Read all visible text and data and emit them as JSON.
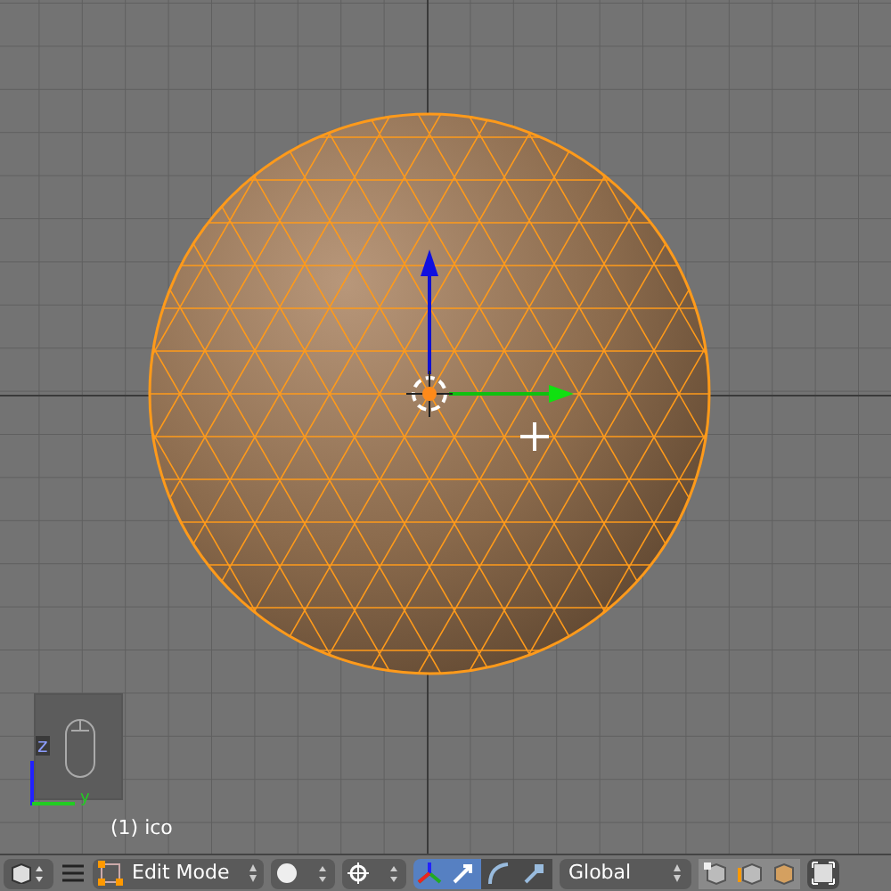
{
  "viewport": {
    "object_label": "(1) ico",
    "axis_labels": [
      "z",
      "y"
    ]
  },
  "header": {
    "mode": "Edit Mode",
    "orientation": "Global",
    "manipulator_enabled": true,
    "manipulators": [
      {
        "kind": "translate",
        "selected": true
      },
      {
        "kind": "rotate",
        "selected": false
      },
      {
        "kind": "scale",
        "selected": false
      }
    ],
    "select_modes": [
      {
        "kind": "vertex",
        "selected": false
      },
      {
        "kind": "edge",
        "selected": false
      },
      {
        "kind": "face",
        "selected": false
      }
    ]
  }
}
